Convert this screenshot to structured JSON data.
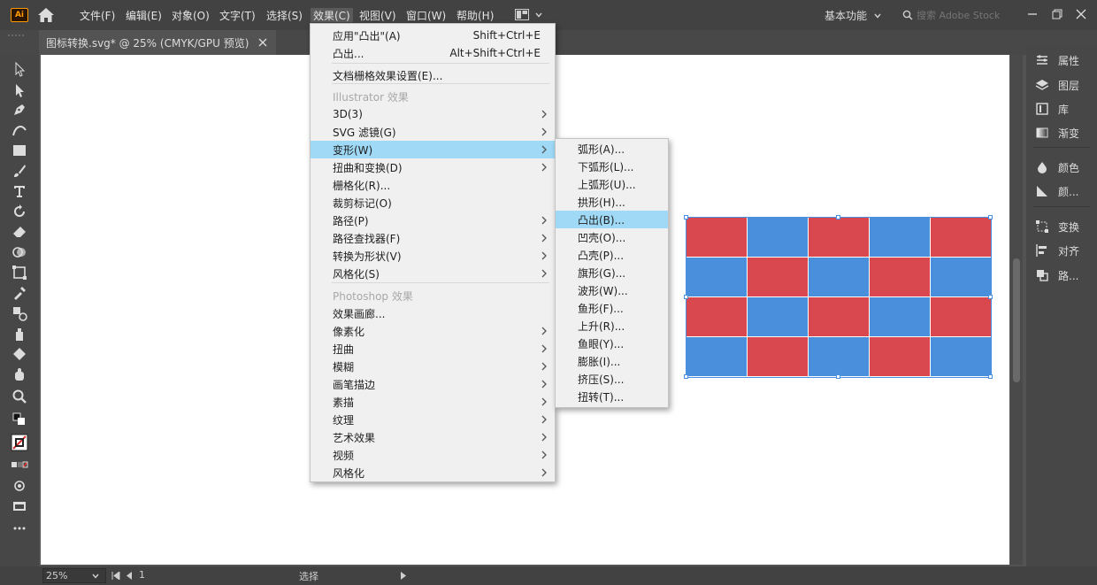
{
  "app": {
    "logo": "Ai",
    "menus": [
      "文件(F)",
      "编辑(E)",
      "对象(O)",
      "文字(T)",
      "选择(S)",
      "效果(C)",
      "视图(V)",
      "窗口(W)",
      "帮助(H)"
    ],
    "active_menu": "效果(C)",
    "workspace_label": "基本功能",
    "search_placeholder": "搜索 Adobe Stock"
  },
  "document": {
    "tab_title": "图标转换.svg* @ 25% (CMYK/GPU 预览)"
  },
  "effect_menu": {
    "items": [
      {
        "label": "应用\"凸出\"(A)",
        "shortcut": "Shift+Ctrl+E"
      },
      {
        "label": "凸出...",
        "shortcut": "Alt+Shift+Ctrl+E"
      },
      {
        "label": "文档栅格效果设置(E)..."
      },
      {
        "label": "Illustrator 效果",
        "disabled": true
      },
      {
        "label": "3D(3)",
        "submenu": true
      },
      {
        "label": "SVG 滤镜(G)",
        "submenu": true
      },
      {
        "label": "变形(W)",
        "submenu": true,
        "highlight": true
      },
      {
        "label": "扭曲和变换(D)",
        "submenu": true
      },
      {
        "label": "栅格化(R)..."
      },
      {
        "label": "裁剪标记(O)"
      },
      {
        "label": "路径(P)",
        "submenu": true
      },
      {
        "label": "路径查找器(F)",
        "submenu": true
      },
      {
        "label": "转换为形状(V)",
        "submenu": true
      },
      {
        "label": "风格化(S)",
        "submenu": true
      },
      {
        "label": "Photoshop 效果",
        "disabled": true
      },
      {
        "label": "效果画廊..."
      },
      {
        "label": "像素化",
        "submenu": true
      },
      {
        "label": "扭曲",
        "submenu": true
      },
      {
        "label": "模糊",
        "submenu": true
      },
      {
        "label": "画笔描边",
        "submenu": true
      },
      {
        "label": "素描",
        "submenu": true
      },
      {
        "label": "纹理",
        "submenu": true
      },
      {
        "label": "艺术效果",
        "submenu": true
      },
      {
        "label": "视频",
        "submenu": true
      },
      {
        "label": "风格化",
        "submenu": true
      }
    ]
  },
  "warp_submenu": {
    "items": [
      "弧形(A)...",
      "下弧形(L)...",
      "上弧形(U)...",
      "拱形(H)...",
      "凸出(B)...",
      "凹壳(O)...",
      "凸壳(P)...",
      "旗形(G)...",
      "波形(W)...",
      "鱼形(F)...",
      "上升(R)...",
      "鱼眼(Y)...",
      "膨胀(I)...",
      "挤压(S)...",
      "扭转(T)..."
    ],
    "highlight_index": 4
  },
  "right_panel": {
    "items": [
      "属性",
      "图层",
      "库",
      "渐变",
      "颜色",
      "颜...",
      "变换",
      "对齐",
      "路..."
    ]
  },
  "status_bar": {
    "zoom": "25%",
    "artboard_number": "1",
    "tool_label": "选择"
  },
  "artwork": {
    "colors": {
      "red": "#d9474f",
      "blue": "#4a8fdb"
    },
    "pattern": [
      [
        "red",
        "blue",
        "red",
        "blue",
        "red"
      ],
      [
        "blue",
        "red",
        "blue",
        "red",
        "blue"
      ],
      [
        "red",
        "blue",
        "red",
        "blue",
        "red"
      ],
      [
        "blue",
        "red",
        "blue",
        "red",
        "blue"
      ]
    ]
  }
}
